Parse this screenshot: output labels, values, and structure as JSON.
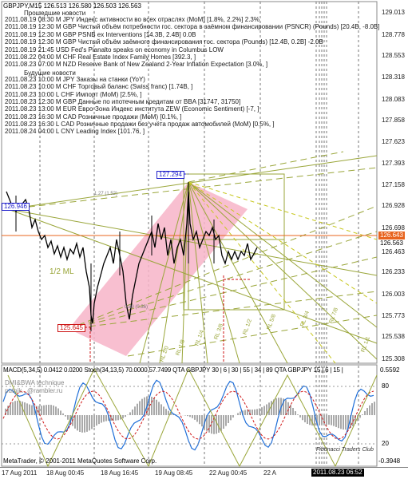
{
  "header": {
    "symbol": "GBPJPY,M15",
    "ohlc": "126.513 126.580 126.503 126.563"
  },
  "news": {
    "past_title": "Прошедшие новости",
    "past_items": [
      "2011.08.19 08:30 M JPY Индекс активности во всех отраслях (MoM) [1.8%, 2.2%] 2.3%",
      "2011.08.19 12:30 M GBP Чистый объём потребности гос. сектора в заёмном финансировании (PSNCR) (Pounds) [20.4B, -8.0B]",
      "2011.08.19 12:30 M GBP PSNB ex Interventions [14.3B, 2.4B] 0.0B",
      "2011.08.19 12:30 M GBP Чистый объём заёмного финансирования гос. сектора (Pounds) [12.4B, 0.2B] -2.0B",
      "2011.08.19 21:45   USD Fed's Pianalto speaks on economy in Columbus  LOW",
      "2011.08.22 04:00 M CHF Real Estate Index Family Homes [392.3, ]",
      "2011.08.23 07:00 M NZD Reserve Bank of New Zealand 2-Year Inflation Expectation [3.0%, ]"
    ],
    "future_title": "Будущие новости",
    "future_items": [
      "2011.08.23 10:00 M JPY Заказы на станки (YoY)",
      "2011.08.23 10:00 M CHF Торговый баланс (Swiss franc) [1.74B, ]",
      "2011.08.23 10:00 L CHF Импорт (MoM) [2.5%, ]",
      "2011.08.23 12:30 M GBP Данные по ипотечным кредитам от BBA [31747, 31750]",
      "2011.08.23 13:00 M EUR Евро-Зона Индекс института ZEW (Economic Sentiment) [-7, ]",
      "2011.08.23 16:30 M CAD Розничные продажи (MoM) [0.1%, ]",
      "2011.08.23 16:30 L CAD Розничные продажи без учёта продаж автомобилей (MoM) [0.5%, ]",
      "2011.08.24 04:00 L CNY Leading Index [101.76, ]"
    ]
  },
  "price_axis": [
    "129.013",
    "128.778",
    "128.553",
    "128.318",
    "128.083",
    "127.858",
    "127.623",
    "127.393",
    "127.158",
    "126.928",
    "126.698",
    "126.643",
    "126.563",
    "126.463",
    "126.233",
    "126.003",
    "125.773",
    "125.538",
    "125.308"
  ],
  "current_price": "126.643",
  "bid_price": "126.563",
  "labels": {
    "price_box_top": "127.294",
    "price_box_left": "126.946",
    "price_box_bottom": "125.645",
    "ml_label": "1/2 ML",
    "ratio_top": "1.27 (1.52)",
    "ratio_mid": "0.89 (0.36)",
    "rl_labels": [
      "RL 1/0",
      "RL 1/8",
      "RL 1/4",
      "RL 3/8",
      "RL 1/2",
      "RL 5/8",
      "RL 3/4",
      "RL 7/8",
      "RL 1/1"
    ]
  },
  "indicator": {
    "header": "MACD(5,34,5) 0.0412 0.0200  Stoch(34,13,5) 70.0000 57.7499  QTA GBPJPY 30 | 6 | 30 | 55 | 34 | 89  QTA GBPJPY 15 | 6 | 15 |",
    "scale": [
      "0.5592",
      "80",
      "20",
      "-0.3948"
    ],
    "watermark_line1": "DMI&BWA technique",
    "watermark_line2": "putnik...@rambler.ru",
    "copyright": "MetaTrader, © 2001-2011 MetaQuotes Software Corp.",
    "club": "Fibonacci Traders Club"
  },
  "time_axis": [
    "17 Aug 2011",
    "18 Aug 00:45",
    "18 Aug 16:45",
    "19 Aug 08:45",
    "22 Aug 00:45",
    "22 A",
    "2011.08.23 06:52"
  ],
  "colors": {
    "bg": "#ffffff",
    "price_up": "#000000",
    "pitch_fill": "#f7b4c8",
    "green_lines": "#9aa63a",
    "current_price": "#e8641e",
    "blue_box": "#2222cc",
    "red_box": "#cc1111",
    "macd": "#9090c8"
  }
}
